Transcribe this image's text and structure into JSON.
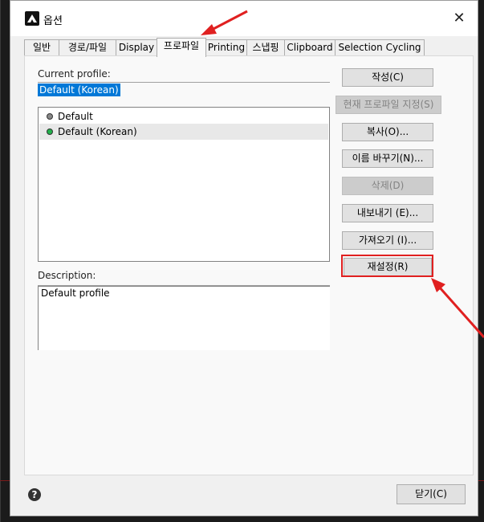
{
  "window": {
    "title": "옵션",
    "close_glyph": "✕"
  },
  "tabs": [
    {
      "label": "일반"
    },
    {
      "label": "경로/파일"
    },
    {
      "label": "Display"
    },
    {
      "label": "프로파일"
    },
    {
      "label": "Printing"
    },
    {
      "label": "스냅핑"
    },
    {
      "label": "Clipboard"
    },
    {
      "label": "Selection Cycling"
    }
  ],
  "active_tab": "프로파일",
  "profile": {
    "current_label": "Current profile:",
    "current_value": "Default (Korean)",
    "list": [
      {
        "label": "Default",
        "status_color": "#888888"
      },
      {
        "label": "Default (Korean)",
        "status_color": "#22b14c"
      }
    ],
    "description_label": "Description:",
    "description_value": "Default profile"
  },
  "buttons": {
    "create": "작성(C)",
    "set_current": "현재 프로파일 지정(S)",
    "copy": "복사(O)...",
    "rename": "이름 바꾸기(N)...",
    "delete": "삭제(D)",
    "export": "내보내기 (E)...",
    "import": "가져오기 (I)...",
    "reset": "재설정(R)",
    "close": "닫기(C)"
  },
  "help_glyph": "?",
  "colors": {
    "accent": "#0078d7",
    "annotation": "#e02020"
  }
}
